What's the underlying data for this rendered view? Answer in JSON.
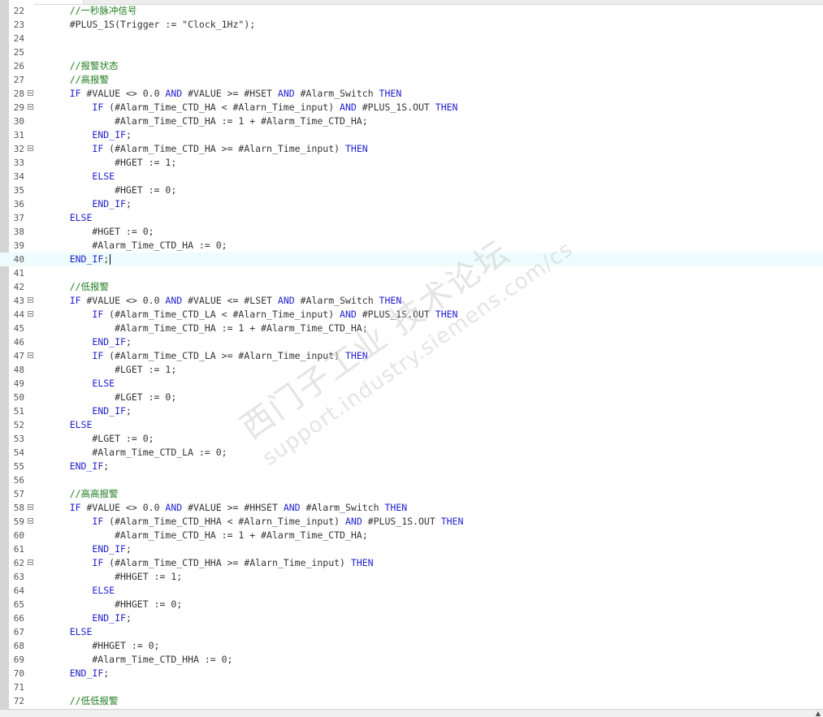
{
  "editor": {
    "lines": [
      {
        "n": "22",
        "fold": false,
        "code": [
          {
            "t": "    "
          },
          {
            "c": "cmt",
            "t": "//一秒脉冲信号"
          }
        ]
      },
      {
        "n": "23",
        "fold": false,
        "code": [
          {
            "t": "    #PLUS_1S(Trigger := \"Clock_1Hz\");"
          }
        ]
      },
      {
        "n": "24",
        "fold": false,
        "code": [
          {
            "t": ""
          }
        ]
      },
      {
        "n": "25",
        "fold": false,
        "code": [
          {
            "t": ""
          }
        ]
      },
      {
        "n": "26",
        "fold": false,
        "code": [
          {
            "t": "    "
          },
          {
            "c": "cmt",
            "t": "//报警状态"
          }
        ]
      },
      {
        "n": "27",
        "fold": false,
        "code": [
          {
            "t": "    "
          },
          {
            "c": "cmt",
            "t": "//高报警"
          }
        ]
      },
      {
        "n": "28",
        "fold": true,
        "code": [
          {
            "t": "    "
          },
          {
            "c": "kw",
            "t": "IF"
          },
          {
            "t": " #VALUE <> 0.0 "
          },
          {
            "c": "kw",
            "t": "AND"
          },
          {
            "t": " #VALUE >= #HSET "
          },
          {
            "c": "kw",
            "t": "AND"
          },
          {
            "t": " #Alarm_Switch "
          },
          {
            "c": "kw",
            "t": "THEN"
          }
        ]
      },
      {
        "n": "29",
        "fold": true,
        "code": [
          {
            "t": "        "
          },
          {
            "c": "kw",
            "t": "IF"
          },
          {
            "t": " (#Alarm_Time_CTD_HA < #Alarn_Time_input) "
          },
          {
            "c": "kw",
            "t": "AND"
          },
          {
            "t": " #PLUS_1S.OUT "
          },
          {
            "c": "kw",
            "t": "THEN"
          }
        ]
      },
      {
        "n": "30",
        "fold": false,
        "code": [
          {
            "t": "            #Alarm_Time_CTD_HA := 1 + #Alarm_Time_CTD_HA;"
          }
        ]
      },
      {
        "n": "31",
        "fold": false,
        "code": [
          {
            "t": "        "
          },
          {
            "c": "kw",
            "t": "END_IF"
          },
          {
            "t": ";"
          }
        ]
      },
      {
        "n": "32",
        "fold": true,
        "code": [
          {
            "t": "        "
          },
          {
            "c": "kw",
            "t": "IF"
          },
          {
            "t": " (#Alarm_Time_CTD_HA >= #Alarn_Time_input) "
          },
          {
            "c": "kw",
            "t": "THEN"
          }
        ]
      },
      {
        "n": "33",
        "fold": false,
        "code": [
          {
            "t": "            #HGET := 1;"
          }
        ]
      },
      {
        "n": "34",
        "fold": false,
        "code": [
          {
            "t": "        "
          },
          {
            "c": "kw",
            "t": "ELSE"
          }
        ]
      },
      {
        "n": "35",
        "fold": false,
        "code": [
          {
            "t": "            #HGET := 0;"
          }
        ]
      },
      {
        "n": "36",
        "fold": false,
        "code": [
          {
            "t": "        "
          },
          {
            "c": "kw",
            "t": "END_IF"
          },
          {
            "t": ";"
          }
        ]
      },
      {
        "n": "37",
        "fold": false,
        "code": [
          {
            "t": "    "
          },
          {
            "c": "kw",
            "t": "ELSE"
          }
        ]
      },
      {
        "n": "38",
        "fold": false,
        "code": [
          {
            "t": "        #HGET := 0;"
          }
        ]
      },
      {
        "n": "39",
        "fold": false,
        "code": [
          {
            "t": "        #Alarm_Time_CTD_HA := 0;"
          }
        ]
      },
      {
        "n": "40",
        "fold": false,
        "current": true,
        "code": [
          {
            "t": "    "
          },
          {
            "c": "kw",
            "t": "END_IF"
          },
          {
            "t": ";"
          }
        ]
      },
      {
        "n": "41",
        "fold": false,
        "code": [
          {
            "t": ""
          }
        ]
      },
      {
        "n": "42",
        "fold": false,
        "code": [
          {
            "t": "    "
          },
          {
            "c": "cmt",
            "t": "//低报警"
          }
        ]
      },
      {
        "n": "43",
        "fold": true,
        "code": [
          {
            "t": "    "
          },
          {
            "c": "kw",
            "t": "IF"
          },
          {
            "t": " #VALUE <> 0.0 "
          },
          {
            "c": "kw",
            "t": "AND"
          },
          {
            "t": " #VALUE <= #LSET "
          },
          {
            "c": "kw",
            "t": "AND"
          },
          {
            "t": " #Alarm_Switch "
          },
          {
            "c": "kw",
            "t": "THEN"
          }
        ]
      },
      {
        "n": "44",
        "fold": true,
        "code": [
          {
            "t": "        "
          },
          {
            "c": "kw",
            "t": "IF"
          },
          {
            "t": " (#Alarm_Time_CTD_LA < #Alarn_Time_input) "
          },
          {
            "c": "kw",
            "t": "AND"
          },
          {
            "t": " #PLUS_1S.OUT "
          },
          {
            "c": "kw",
            "t": "THEN"
          }
        ]
      },
      {
        "n": "45",
        "fold": false,
        "code": [
          {
            "t": "            #Alarm_Time_CTD_HA := 1 + #Alarm_Time_CTD_HA;"
          }
        ]
      },
      {
        "n": "46",
        "fold": false,
        "code": [
          {
            "t": "        "
          },
          {
            "c": "kw",
            "t": "END_IF"
          },
          {
            "t": ";"
          }
        ]
      },
      {
        "n": "47",
        "fold": true,
        "code": [
          {
            "t": "        "
          },
          {
            "c": "kw",
            "t": "IF"
          },
          {
            "t": " (#Alarm_Time_CTD_LA >= #Alarn_Time_input) "
          },
          {
            "c": "kw",
            "t": "THEN"
          }
        ]
      },
      {
        "n": "48",
        "fold": false,
        "code": [
          {
            "t": "            #LGET := 1;"
          }
        ]
      },
      {
        "n": "49",
        "fold": false,
        "code": [
          {
            "t": "        "
          },
          {
            "c": "kw",
            "t": "ELSE"
          }
        ]
      },
      {
        "n": "50",
        "fold": false,
        "code": [
          {
            "t": "            #LGET := 0;"
          }
        ]
      },
      {
        "n": "51",
        "fold": false,
        "code": [
          {
            "t": "        "
          },
          {
            "c": "kw",
            "t": "END_IF"
          },
          {
            "t": ";"
          }
        ]
      },
      {
        "n": "52",
        "fold": false,
        "code": [
          {
            "t": "    "
          },
          {
            "c": "kw",
            "t": "ELSE"
          }
        ]
      },
      {
        "n": "53",
        "fold": false,
        "code": [
          {
            "t": "        #LGET := 0;"
          }
        ]
      },
      {
        "n": "54",
        "fold": false,
        "code": [
          {
            "t": "        #Alarm_Time_CTD_LA := 0;"
          }
        ]
      },
      {
        "n": "55",
        "fold": false,
        "code": [
          {
            "t": "    "
          },
          {
            "c": "kw",
            "t": "END_IF"
          },
          {
            "t": ";"
          }
        ]
      },
      {
        "n": "56",
        "fold": false,
        "code": [
          {
            "t": ""
          }
        ]
      },
      {
        "n": "57",
        "fold": false,
        "code": [
          {
            "t": "    "
          },
          {
            "c": "cmt",
            "t": "//高高报警"
          }
        ]
      },
      {
        "n": "58",
        "fold": true,
        "code": [
          {
            "t": "    "
          },
          {
            "c": "kw",
            "t": "IF"
          },
          {
            "t": " #VALUE <> 0.0 "
          },
          {
            "c": "kw",
            "t": "AND"
          },
          {
            "t": " #VALUE >= #HHSET "
          },
          {
            "c": "kw",
            "t": "AND"
          },
          {
            "t": " #Alarm_Switch "
          },
          {
            "c": "kw",
            "t": "THEN"
          }
        ]
      },
      {
        "n": "59",
        "fold": true,
        "code": [
          {
            "t": "        "
          },
          {
            "c": "kw",
            "t": "IF"
          },
          {
            "t": " (#Alarm_Time_CTD_HHA < #Alarn_Time_input) "
          },
          {
            "c": "kw",
            "t": "AND"
          },
          {
            "t": " #PLUS_1S.OUT "
          },
          {
            "c": "kw",
            "t": "THEN"
          }
        ]
      },
      {
        "n": "60",
        "fold": false,
        "code": [
          {
            "t": "            #Alarm_Time_CTD_HA := 1 + #Alarm_Time_CTD_HA;"
          }
        ]
      },
      {
        "n": "61",
        "fold": false,
        "code": [
          {
            "t": "        "
          },
          {
            "c": "kw",
            "t": "END_IF"
          },
          {
            "t": ";"
          }
        ]
      },
      {
        "n": "62",
        "fold": true,
        "code": [
          {
            "t": "        "
          },
          {
            "c": "kw",
            "t": "IF"
          },
          {
            "t": " (#Alarm_Time_CTD_HHA >= #Alarn_Time_input) "
          },
          {
            "c": "kw",
            "t": "THEN"
          }
        ]
      },
      {
        "n": "63",
        "fold": false,
        "code": [
          {
            "t": "            #HHGET := 1;"
          }
        ]
      },
      {
        "n": "64",
        "fold": false,
        "code": [
          {
            "t": "        "
          },
          {
            "c": "kw",
            "t": "ELSE"
          }
        ]
      },
      {
        "n": "65",
        "fold": false,
        "code": [
          {
            "t": "            #HHGET := 0;"
          }
        ]
      },
      {
        "n": "66",
        "fold": false,
        "code": [
          {
            "t": "        "
          },
          {
            "c": "kw",
            "t": "END_IF"
          },
          {
            "t": ";"
          }
        ]
      },
      {
        "n": "67",
        "fold": false,
        "code": [
          {
            "t": "    "
          },
          {
            "c": "kw",
            "t": "ELSE"
          }
        ]
      },
      {
        "n": "68",
        "fold": false,
        "code": [
          {
            "t": "        #HHGET := 0;"
          }
        ]
      },
      {
        "n": "69",
        "fold": false,
        "code": [
          {
            "t": "        #Alarm_Time_CTD_HHA := 0;"
          }
        ]
      },
      {
        "n": "70",
        "fold": false,
        "code": [
          {
            "t": "    "
          },
          {
            "c": "kw",
            "t": "END_IF"
          },
          {
            "t": ";"
          }
        ]
      },
      {
        "n": "71",
        "fold": false,
        "code": [
          {
            "t": ""
          }
        ]
      },
      {
        "n": "72",
        "fold": false,
        "code": [
          {
            "t": "    "
          },
          {
            "c": "cmt",
            "t": "//低低报警"
          }
        ]
      }
    ]
  },
  "watermark": {
    "line1": "西门子工业 技术论坛",
    "line2": "support.industry.siemens.com/cs"
  },
  "colors": {
    "keyword": "#1f1fcf",
    "comment": "#237d23",
    "text": "#333333",
    "current_line": "#eefcfd"
  }
}
